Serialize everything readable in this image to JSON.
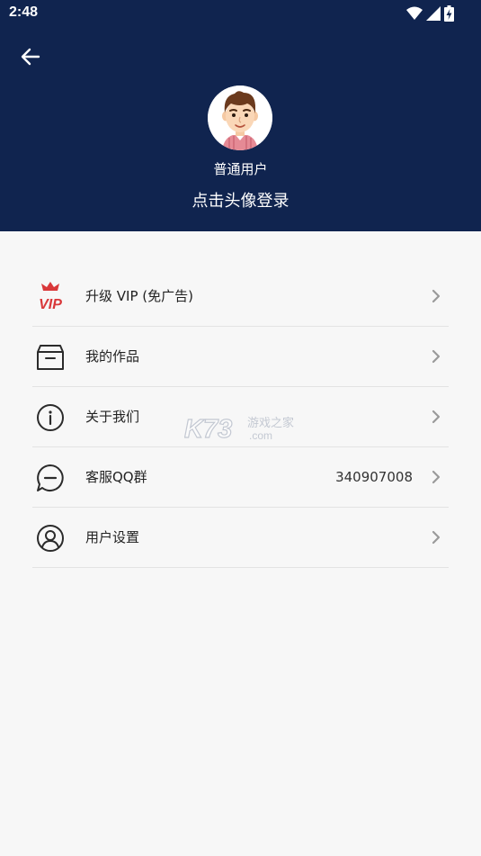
{
  "status_bar": {
    "time": "2:48",
    "icons": [
      "wifi-icon",
      "signal-icon",
      "battery-charging-icon"
    ]
  },
  "header": {
    "background_color": "#10244f",
    "back_icon": "arrow-left-icon",
    "avatar_icon": "cartoon-boy-avatar",
    "user_type": "普通用户",
    "login_hint": "点击头像登录"
  },
  "menu": {
    "items": [
      {
        "icon": "vip-crown-icon",
        "label": "升级 VIP (免广告)",
        "value": ""
      },
      {
        "icon": "box-icon",
        "label": "我的作品",
        "value": ""
      },
      {
        "icon": "info-icon",
        "label": "关于我们",
        "value": ""
      },
      {
        "icon": "chat-bubble-icon",
        "label": "客服QQ群",
        "value": "340907008"
      },
      {
        "icon": "user-icon",
        "label": "用户设置",
        "value": ""
      }
    ]
  },
  "watermark": {
    "brand": "K73",
    "text": "游戏之家",
    "domain": ".com"
  },
  "colors": {
    "vip_red": "#d9383a",
    "icon_dark": "#2b2b2b",
    "chevron": "#9a9a9a"
  }
}
